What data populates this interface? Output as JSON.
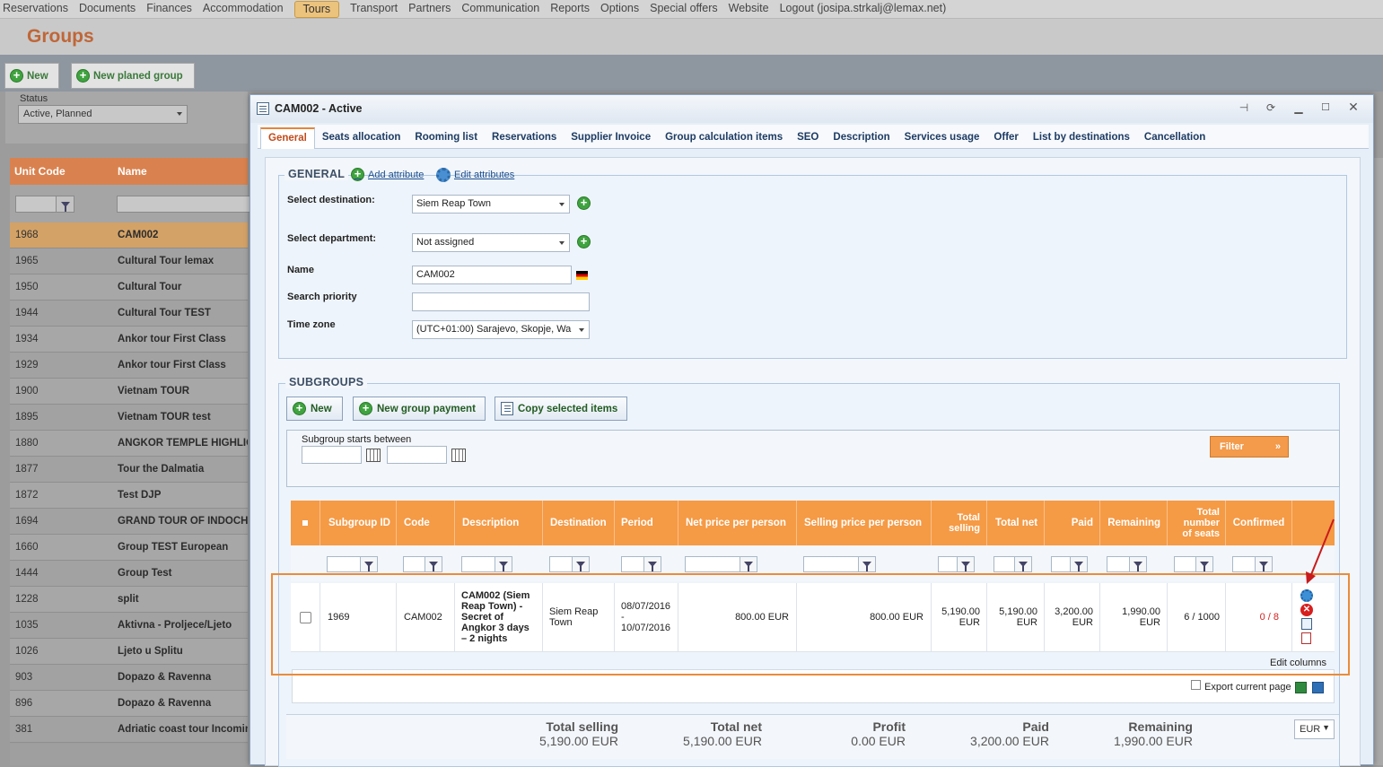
{
  "topnav": {
    "items": [
      "Reservations",
      "Documents",
      "Finances",
      "Accommodation",
      "Tours",
      "Transport",
      "Partners",
      "Communication",
      "Reports",
      "Options",
      "Special offers",
      "Website",
      "Logout (josipa.strkalj@lemax.net)"
    ],
    "active": "Tours"
  },
  "page": {
    "title": "Groups"
  },
  "toolbar": {
    "new_label": "New",
    "new_planed_label": "New planed group"
  },
  "status": {
    "label": "Status",
    "value": "Active, Planned"
  },
  "left_grid": {
    "headers": {
      "unit_code": "Unit Code",
      "name": "Name"
    },
    "rows": [
      {
        "code": "1968",
        "name": "CAM002"
      },
      {
        "code": "1965",
        "name": "Cultural Tour lemax"
      },
      {
        "code": "1950",
        "name": "Cultural Tour"
      },
      {
        "code": "1944",
        "name": "Cultural Tour TEST"
      },
      {
        "code": "1934",
        "name": "Ankor tour First Class"
      },
      {
        "code": "1929",
        "name": "Ankor tour First Class"
      },
      {
        "code": "1900",
        "name": "Vietnam TOUR"
      },
      {
        "code": "1895",
        "name": "Vietnam TOUR test"
      },
      {
        "code": "1880",
        "name": "ANGKOR TEMPLE HIGHLIGHTS"
      },
      {
        "code": "1877",
        "name": "Tour the Dalmatia"
      },
      {
        "code": "1872",
        "name": "Test DJP"
      },
      {
        "code": "1694",
        "name": "GRAND TOUR OF INDOCHINA"
      },
      {
        "code": "1660",
        "name": "Group TEST European"
      },
      {
        "code": "1444",
        "name": "Group Test"
      },
      {
        "code": "1228",
        "name": "split"
      },
      {
        "code": "1035",
        "name": "Aktivna - Proljece/Ljeto"
      },
      {
        "code": "1026",
        "name": "Ljeto u Splitu"
      },
      {
        "code": "903",
        "name": "Dopazo & Ravenna"
      },
      {
        "code": "896",
        "name": "Dopazo & Ravenna"
      },
      {
        "code": "381",
        "name": "Adriatic coast tour Incoming"
      }
    ]
  },
  "modal": {
    "title": "CAM002 - Active",
    "tabs": [
      "General",
      "Seats allocation",
      "Rooming list",
      "Reservations",
      "Supplier Invoice",
      "Group calculation items",
      "SEO",
      "Description",
      "Services usage",
      "Offer",
      "List by destinations",
      "Cancellation"
    ],
    "active_tab": "General",
    "general": {
      "legend": "GENERAL",
      "add_attribute": "Add attribute",
      "edit_attributes": "Edit attributes",
      "destination_label": "Select destination:",
      "destination_value": "Siem Reap Town",
      "department_label": "Select department:",
      "department_value": "Not assigned",
      "name_label": "Name",
      "name_value": "CAM002",
      "priority_label": "Search priority",
      "priority_value": "",
      "timezone_label": "Time zone",
      "timezone_value": "(UTC+01:00) Sarajevo, Skopje, Wa"
    },
    "subgroups": {
      "legend": "SUBGROUPS",
      "new_label": "New",
      "payment_label": "New group payment",
      "copy_label": "Copy selected items",
      "starts_between_label": "Subgroup starts between",
      "filter_label": "Filter",
      "columns": {
        "subgroup_id": "Subgroup ID",
        "code": "Code",
        "description": "Description",
        "destination": "Destination",
        "period": "Period",
        "net_pp": "Net price per person",
        "sell_pp": "Selling price per person",
        "total_selling_1": "Total",
        "total_selling_2": "selling",
        "total_net": "Total net",
        "paid": "Paid",
        "remaining": "Remaining",
        "seats_1": "Total",
        "seats_2": "number",
        "seats_3": "of seats",
        "confirmed": "Confirmed"
      },
      "row": {
        "id": "1969",
        "code": "CAM002",
        "description": "CAM002 (Siem Reap Town) - Secret of Angkor 3 days – 2 nights",
        "destination": "Siem Reap Town",
        "period_start": "08/07/2016",
        "period_sep": "-",
        "period_end": "10/07/2016",
        "net_pp": "800.00 EUR",
        "sell_pp": "800.00 EUR",
        "total_selling_amount": "5,190.00",
        "total_selling_currency": "EUR",
        "total_net_amount": "5,190.00",
        "total_net_currency": "EUR",
        "paid_amount": "3,200.00",
        "paid_currency": "EUR",
        "remaining_amount": "1,990.00",
        "remaining_currency": "EUR",
        "seats": "6 / 1000",
        "confirmed": "0 / 8"
      },
      "edit_columns": "Edit columns",
      "export_label": "Export current page",
      "totals": {
        "selling_label": "Total selling",
        "selling_value": "5,190.00 EUR",
        "net_label": "Total net",
        "net_value": "5,190.00 EUR",
        "profit_label": "Profit",
        "profit_value": "0.00 EUR",
        "paid_label": "Paid",
        "paid_value": "3,200.00 EUR",
        "remaining_label": "Remaining",
        "remaining_value": "1,990.00 EUR",
        "currency": "EUR"
      }
    }
  },
  "colors": {
    "accent_orange": "#f59a45",
    "title_orange": "#c06637",
    "link_blue": "#1d4f8f",
    "highlight": "#ea8b3b",
    "arrow_red": "#c81b1b"
  }
}
